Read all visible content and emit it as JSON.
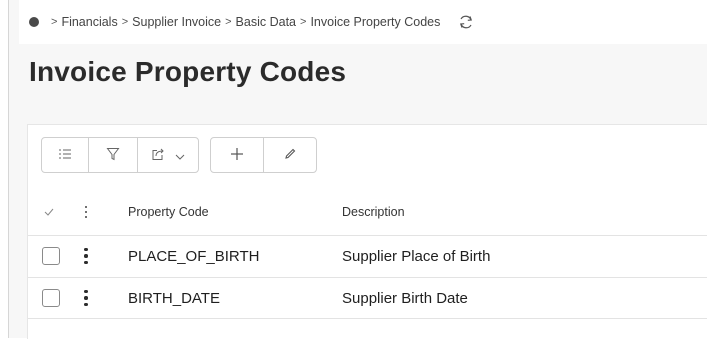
{
  "breadcrumb": {
    "items": [
      "Financials",
      "Supplier Invoice",
      "Basic Data",
      "Invoice Property Codes"
    ],
    "separator": ">"
  },
  "page": {
    "title": "Invoice Property Codes"
  },
  "toolbar": {
    "buttons": [
      {
        "icon": "list-icon"
      },
      {
        "icon": "filter-icon"
      },
      {
        "icon": "export-icon",
        "has_dropdown": true
      },
      {
        "icon": "plus-icon"
      },
      {
        "icon": "edit-icon"
      }
    ]
  },
  "table": {
    "columns": [
      "Property Code",
      "Description"
    ],
    "rows": [
      {
        "code": "PLACE_OF_BIRTH",
        "description": "Supplier Place of Birth"
      },
      {
        "code": "BIRTH_DATE",
        "description": "Supplier Birth Date"
      }
    ]
  },
  "colors": {
    "title": "#2b2b2b",
    "border": "#cfcfcf",
    "background": "#f7f7f7"
  }
}
